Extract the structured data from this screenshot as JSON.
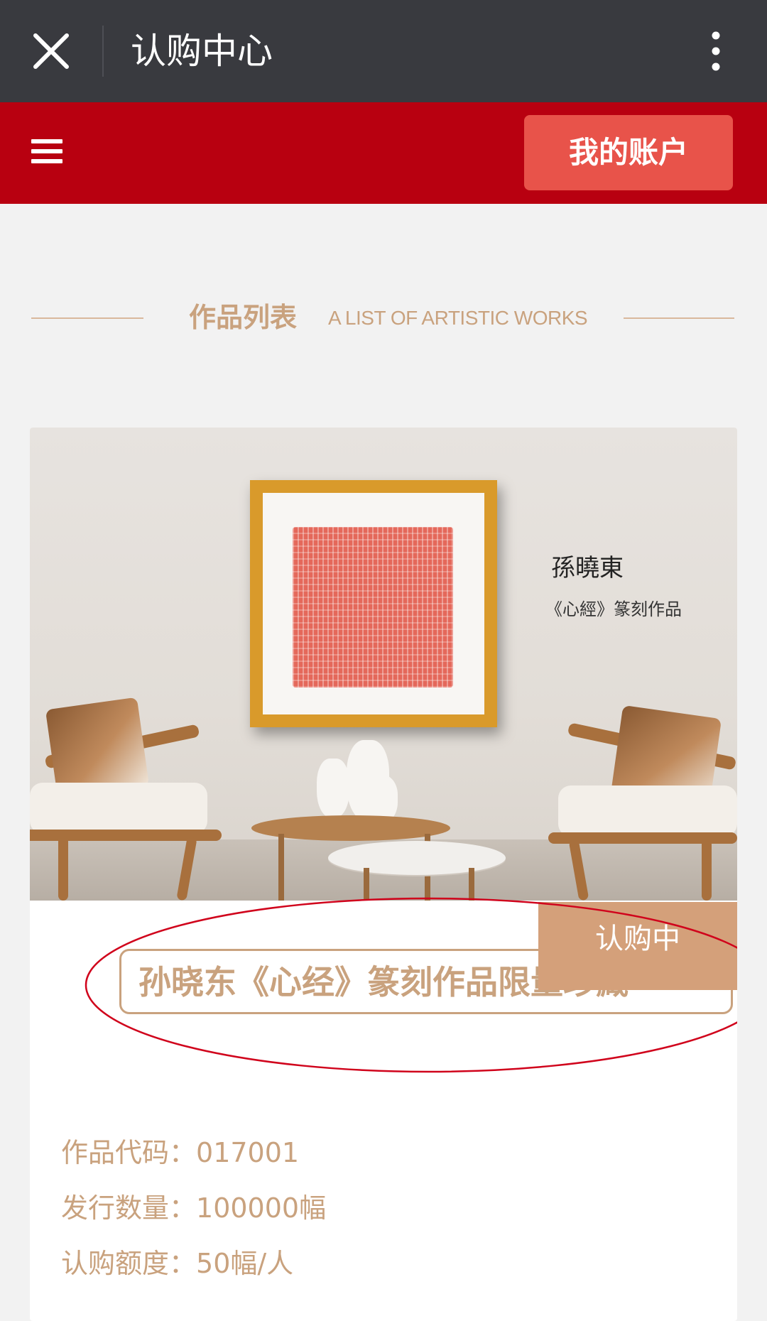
{
  "topbar": {
    "title": "认购中心"
  },
  "header": {
    "account_button": "我的账户"
  },
  "section": {
    "title_zh": "作品列表",
    "title_en": "A LIST OF ARTISTIC WORKS"
  },
  "product": {
    "image_text": {
      "artist": "孫曉東",
      "caption": "《心經》篆刻作品"
    },
    "status": "认购中",
    "title": "孙晓东《心经》篆刻作品限量珍藏",
    "fields": [
      {
        "label": "作品代码：",
        "value": "017001"
      },
      {
        "label": "发行数量：",
        "value": "100000幅"
      },
      {
        "label": "认购额度：",
        "value": "50幅/人"
      }
    ]
  },
  "colors": {
    "topbar": "#393a3f",
    "header_red": "#b80010",
    "account_button": "#e8534a",
    "accent_tan": "#c9a27e",
    "tag": "#d4a07a",
    "annotation": "#d0021b"
  }
}
